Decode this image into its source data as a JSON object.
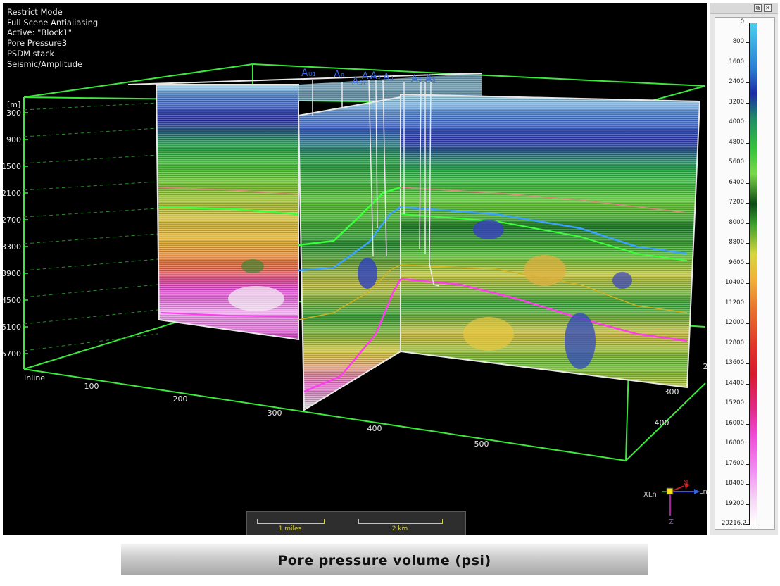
{
  "overlay": {
    "lines": [
      "Restrict Mode",
      "Full Scene Antialiasing",
      "Active: \"Block1\"",
      "Pore Pressure3",
      "PSDM stack",
      "Seismic/Amplitude"
    ]
  },
  "depth_axis": {
    "unit": "[m]",
    "ticks": [
      "300",
      "900",
      "1500",
      "2100",
      "2700",
      "3300",
      "3900",
      "4500",
      "5100",
      "5700"
    ]
  },
  "inline_axis": {
    "label": "Inline",
    "ticks": [
      "100",
      "200",
      "300",
      "400",
      "500"
    ]
  },
  "xline_axis": {
    "ticks": [
      "300",
      "400",
      "2"
    ]
  },
  "wells": [
    "U1",
    "8",
    "57",
    "44",
    "3",
    "4",
    "1",
    "5"
  ],
  "orientation": {
    "x_label": "XLn",
    "y_label": "ILn",
    "north_label": "N",
    "z_label": "Z"
  },
  "scalebar": {
    "miles_label": "1 miles",
    "km_label": "2 km"
  },
  "colorbar": {
    "ticks": [
      "0",
      "800",
      "1600",
      "2400",
      "3200",
      "4000",
      "4800",
      "5600",
      "6400",
      "7200",
      "8000",
      "8800",
      "9600",
      "10400",
      "11200",
      "12000",
      "12800",
      "13600",
      "14400",
      "15200",
      "16000",
      "16800",
      "17600",
      "18400",
      "19200",
      "20216.2"
    ]
  },
  "caption": "Pore pressure volume (psi)",
  "colors": {
    "box": "#3ce83c",
    "text": "#e8e8e8",
    "well_label": "#3a6ae0",
    "scalebar": "#d6d03a"
  }
}
